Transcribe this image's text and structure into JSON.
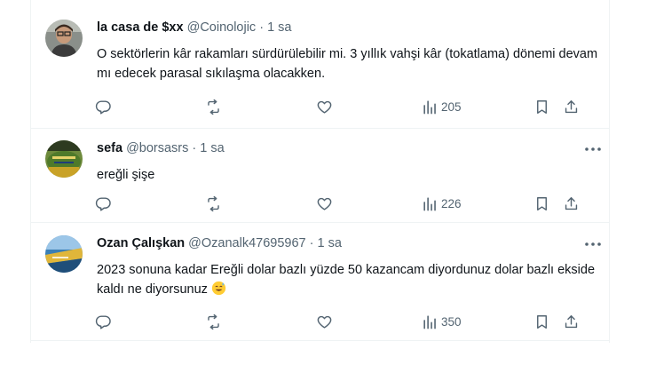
{
  "tweets": [
    {
      "name": "la casa de $xx",
      "handle": "@Coinolojic",
      "separator": "·",
      "time": "1 sa",
      "text": "O sektörlerin kâr rakamları sürdürülebilir mi. 3 yıllık vahşi kâr (tokatlama) dönemi devam mı edecek parasal sıkılaşma olacakken.",
      "views": "205"
    },
    {
      "name": "sefa",
      "handle": "@borsasrs",
      "separator": "·",
      "time": "1 sa",
      "text": "ereğli şişe",
      "views": "226"
    },
    {
      "name": "Ozan Çalışkan",
      "handle": "@Ozanalk47695967",
      "separator": "·",
      "time": "1 sa",
      "text": "2023 sonuna kadar Ereğli dolar bazlı yüzde 50 kazancam diyordunuz dolar bazlı ekside kaldı ne diyorsunuz",
      "emoji": "sweat-smile-emoji",
      "views": "350"
    }
  ],
  "icons": {
    "reply": "reply-icon",
    "retweet": "retweet-icon",
    "like": "heart-icon",
    "views": "views-chart-icon",
    "bookmark": "bookmark-icon",
    "share": "share-icon",
    "more": "more-dots-icon"
  },
  "colors": {
    "text": "#0f1419",
    "secondary": "#536471",
    "divider": "#eff3f4"
  }
}
